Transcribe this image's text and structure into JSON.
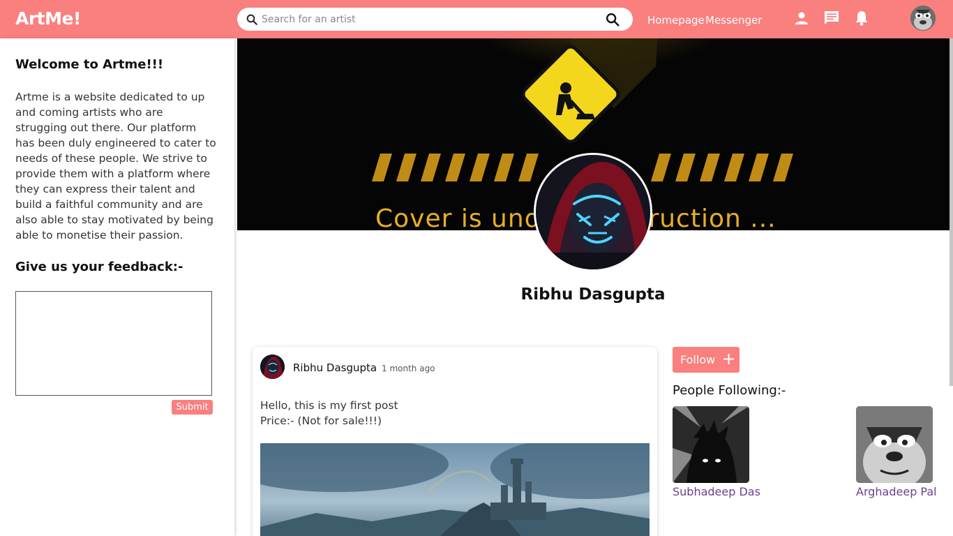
{
  "header": {
    "logo": "ArtMe!",
    "search_placeholder": "Search for an artist",
    "nav": [
      "Homepage",
      "Messenger"
    ],
    "icons": [
      "person-icon",
      "chat-icon",
      "bell-icon"
    ],
    "brand_color": "#fa7f7f"
  },
  "sidebar": {
    "welcome_title": "Welcome to Artme!!!",
    "about": "Artme is a website dedicated to up and coming artists who are strugging out there. Our platform has been duly engineered to cater to needs of these people. We strive to provide them with a platform where they can express their talent and build a faithful community and are also able to stay motivated by being able to monetise their passion.",
    "feedback_title": "Give us your feedback:-",
    "feedback_value": "",
    "submit_label": "Submit"
  },
  "profile": {
    "cover_text": "Cover is under construction ...",
    "name": "Ribhu Dasgupta"
  },
  "post": {
    "author": "Ribhu Dasgupta",
    "time": "1 month ago",
    "line1": "Hello, this is my first post",
    "line2": "Price:- (Not for sale!!!)"
  },
  "right_panel": {
    "follow_label": "Follow",
    "following_title": "People Following:-",
    "following": [
      {
        "name": "Subhadeep Das"
      },
      {
        "name": "Arghadeep Pal"
      }
    ]
  }
}
